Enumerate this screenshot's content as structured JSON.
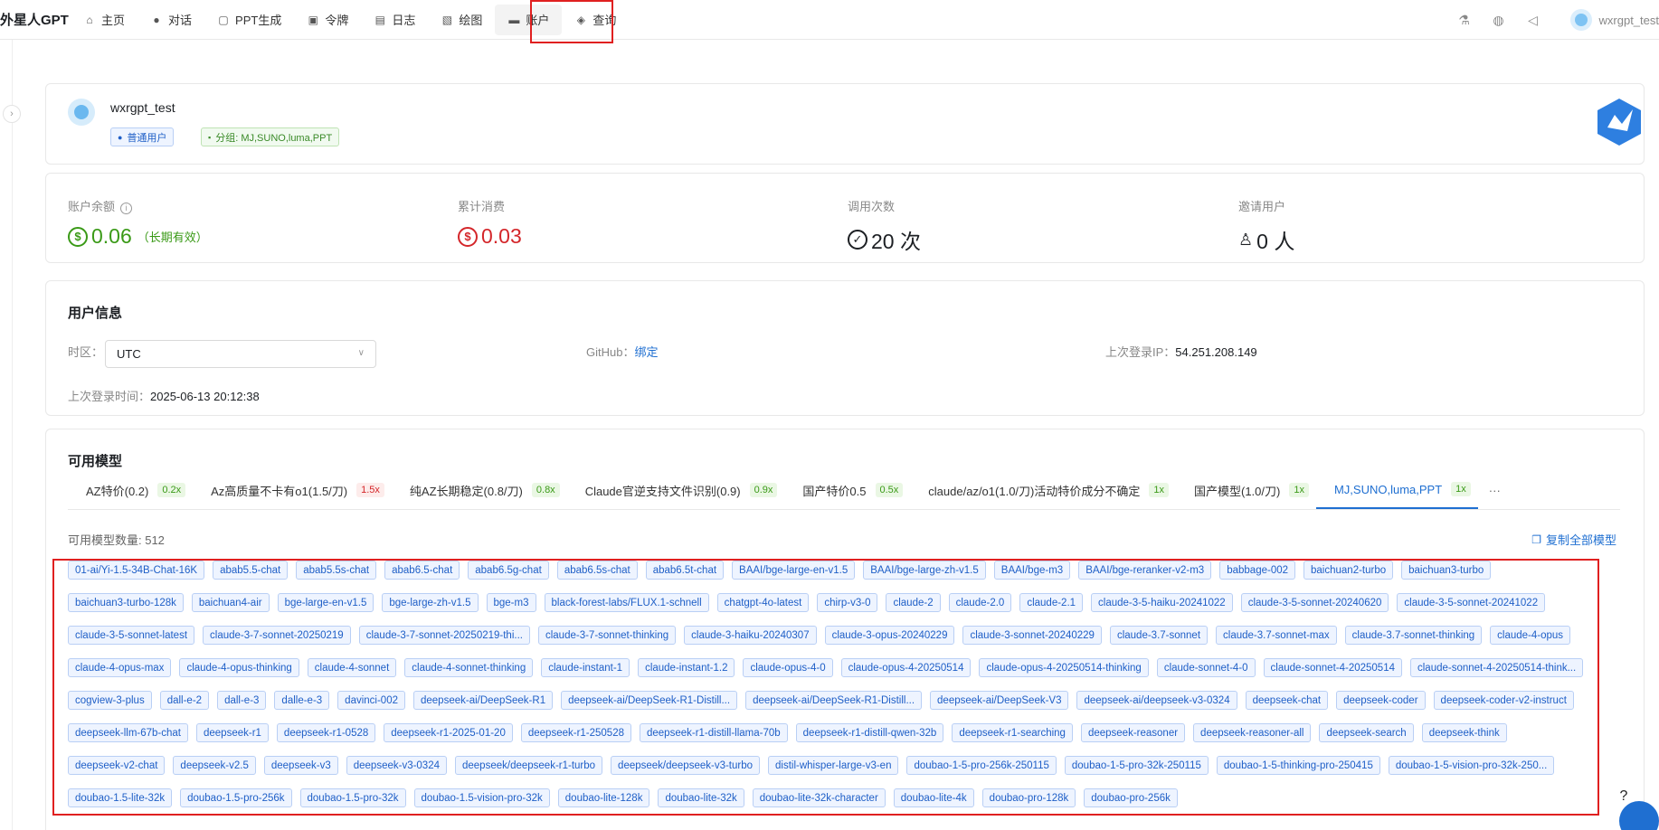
{
  "app": {
    "title": "外星人GPT"
  },
  "nav": [
    {
      "label": "主页",
      "icon": "home-icon",
      "glyph": "⌂"
    },
    {
      "label": "对话",
      "icon": "chat-icon",
      "glyph": "●"
    },
    {
      "label": "PPT生成",
      "icon": "ppt-icon",
      "glyph": "▢"
    },
    {
      "label": "令牌",
      "icon": "lock-icon",
      "glyph": "▣"
    },
    {
      "label": "日志",
      "icon": "log-icon",
      "glyph": "▤"
    },
    {
      "label": "绘图",
      "icon": "image-icon",
      "glyph": "▧"
    },
    {
      "label": "账户",
      "icon": "account-icon",
      "glyph": "▬"
    },
    {
      "label": "查询",
      "icon": "query-icon",
      "glyph": "◈"
    }
  ],
  "user": {
    "name": "wxrgpt_test"
  },
  "profile": {
    "name": "wxrgpt_test",
    "role_badge": "普通用户",
    "group_badge": "分组: MJ,SUNO,luma,PPT"
  },
  "stats": {
    "balance": {
      "label": "账户余额",
      "value": "0.06",
      "note": "（长期有效）"
    },
    "spent": {
      "label": "累计消费",
      "value": "0.03"
    },
    "calls": {
      "label": "调用次数",
      "value": "20 次"
    },
    "invites": {
      "label": "邀请用户",
      "value": "0 人"
    }
  },
  "user_info": {
    "title": "用户信息",
    "timezone_label": "时区：",
    "timezone_value": "UTC",
    "github_label": "GitHub：",
    "github_link": "绑定",
    "ip_label": "上次登录IP：",
    "ip_value": "54.251.208.149",
    "last_login_label": "上次登录时间：",
    "last_login_value": "2025-06-13 20:12:38"
  },
  "models": {
    "title": "可用模型",
    "tabs": [
      {
        "label": "AZ特价(0.2)",
        "mult": "0.2x",
        "tone": "green"
      },
      {
        "label": "Az高质量不卡有o1(1.5/刀)",
        "mult": "1.5x",
        "tone": "red"
      },
      {
        "label": "纯AZ长期稳定(0.8/刀)",
        "mult": "0.8x",
        "tone": "green"
      },
      {
        "label": "Claude官逆支持文件识别(0.9)",
        "mult": "0.9x",
        "tone": "green"
      },
      {
        "label": "国产特价0.5",
        "mult": "0.5x",
        "tone": "green"
      },
      {
        "label": "claude/az/o1(1.0/刀)活动特价成分不确定",
        "mult": "1x",
        "tone": "green"
      },
      {
        "label": "国产模型(1.0/刀)",
        "mult": "1x",
        "tone": "green"
      },
      {
        "label": "MJ,SUNO,luma,PPT",
        "mult": "1x",
        "tone": "green",
        "active": true
      }
    ],
    "more": "···",
    "count_text": "可用模型数量: 512",
    "copy_all": "复制全部模型",
    "list": [
      "01-ai/Yi-1.5-34B-Chat-16K",
      "abab5.5-chat",
      "abab5.5s-chat",
      "abab6.5-chat",
      "abab6.5g-chat",
      "abab6.5s-chat",
      "abab6.5t-chat",
      "BAAI/bge-large-en-v1.5",
      "BAAI/bge-large-zh-v1.5",
      "BAAI/bge-m3",
      "BAAI/bge-reranker-v2-m3",
      "babbage-002",
      "baichuan2-turbo",
      "baichuan3-turbo",
      "baichuan3-turbo-128k",
      "baichuan4-air",
      "bge-large-en-v1.5",
      "bge-large-zh-v1.5",
      "bge-m3",
      "black-forest-labs/FLUX.1-schnell",
      "chatgpt-4o-latest",
      "chirp-v3-0",
      "claude-2",
      "claude-2.0",
      "claude-2.1",
      "claude-3-5-haiku-20241022",
      "claude-3-5-sonnet-20240620",
      "claude-3-5-sonnet-20241022",
      "claude-3-5-sonnet-latest",
      "claude-3-7-sonnet-20250219",
      "claude-3-7-sonnet-20250219-thi...",
      "claude-3-7-sonnet-thinking",
      "claude-3-haiku-20240307",
      "claude-3-opus-20240229",
      "claude-3-sonnet-20240229",
      "claude-3.7-sonnet",
      "claude-3.7-sonnet-max",
      "claude-3.7-sonnet-thinking",
      "claude-4-opus",
      "claude-4-opus-max",
      "claude-4-opus-thinking",
      "claude-4-sonnet",
      "claude-4-sonnet-thinking",
      "claude-instant-1",
      "claude-instant-1.2",
      "claude-opus-4-0",
      "claude-opus-4-20250514",
      "claude-opus-4-20250514-thinking",
      "claude-sonnet-4-0",
      "claude-sonnet-4-20250514",
      "claude-sonnet-4-20250514-think...",
      "cogview-3-plus",
      "dall-e-2",
      "dall-e-3",
      "dalle-e-3",
      "davinci-002",
      "deepseek-ai/DeepSeek-R1",
      "deepseek-ai/DeepSeek-R1-Distill...",
      "deepseek-ai/DeepSeek-R1-Distill...",
      "deepseek-ai/DeepSeek-V3",
      "deepseek-ai/deepseek-v3-0324",
      "deepseek-chat",
      "deepseek-coder",
      "deepseek-coder-v2-instruct",
      "deepseek-llm-67b-chat",
      "deepseek-r1",
      "deepseek-r1-0528",
      "deepseek-r1-2025-01-20",
      "deepseek-r1-250528",
      "deepseek-r1-distill-llama-70b",
      "deepseek-r1-distill-qwen-32b",
      "deepseek-r1-searching",
      "deepseek-reasoner",
      "deepseek-reasoner-all",
      "deepseek-search",
      "deepseek-think",
      "deepseek-v2-chat",
      "deepseek-v2.5",
      "deepseek-v3",
      "deepseek-v3-0324",
      "deepseek/deepseek-r1-turbo",
      "deepseek/deepseek-v3-turbo",
      "distil-whisper-large-v3-en",
      "doubao-1-5-pro-256k-250115",
      "doubao-1-5-pro-32k-250115",
      "doubao-1-5-thinking-pro-250415",
      "doubao-1-5-vision-pro-32k-250...",
      "doubao-1.5-lite-32k",
      "doubao-1.5-pro-256k",
      "doubao-1.5-pro-32k",
      "doubao-1.5-vision-pro-32k",
      "doubao-lite-128k",
      "doubao-lite-32k",
      "doubao-lite-32k-character",
      "doubao-lite-4k",
      "doubao-pro-128k",
      "doubao-pro-256k"
    ]
  },
  "colors": {
    "accent": "#1f6fd1",
    "highlight": "#e02020",
    "positive": "#3a9a17",
    "negative": "#d4262a"
  }
}
